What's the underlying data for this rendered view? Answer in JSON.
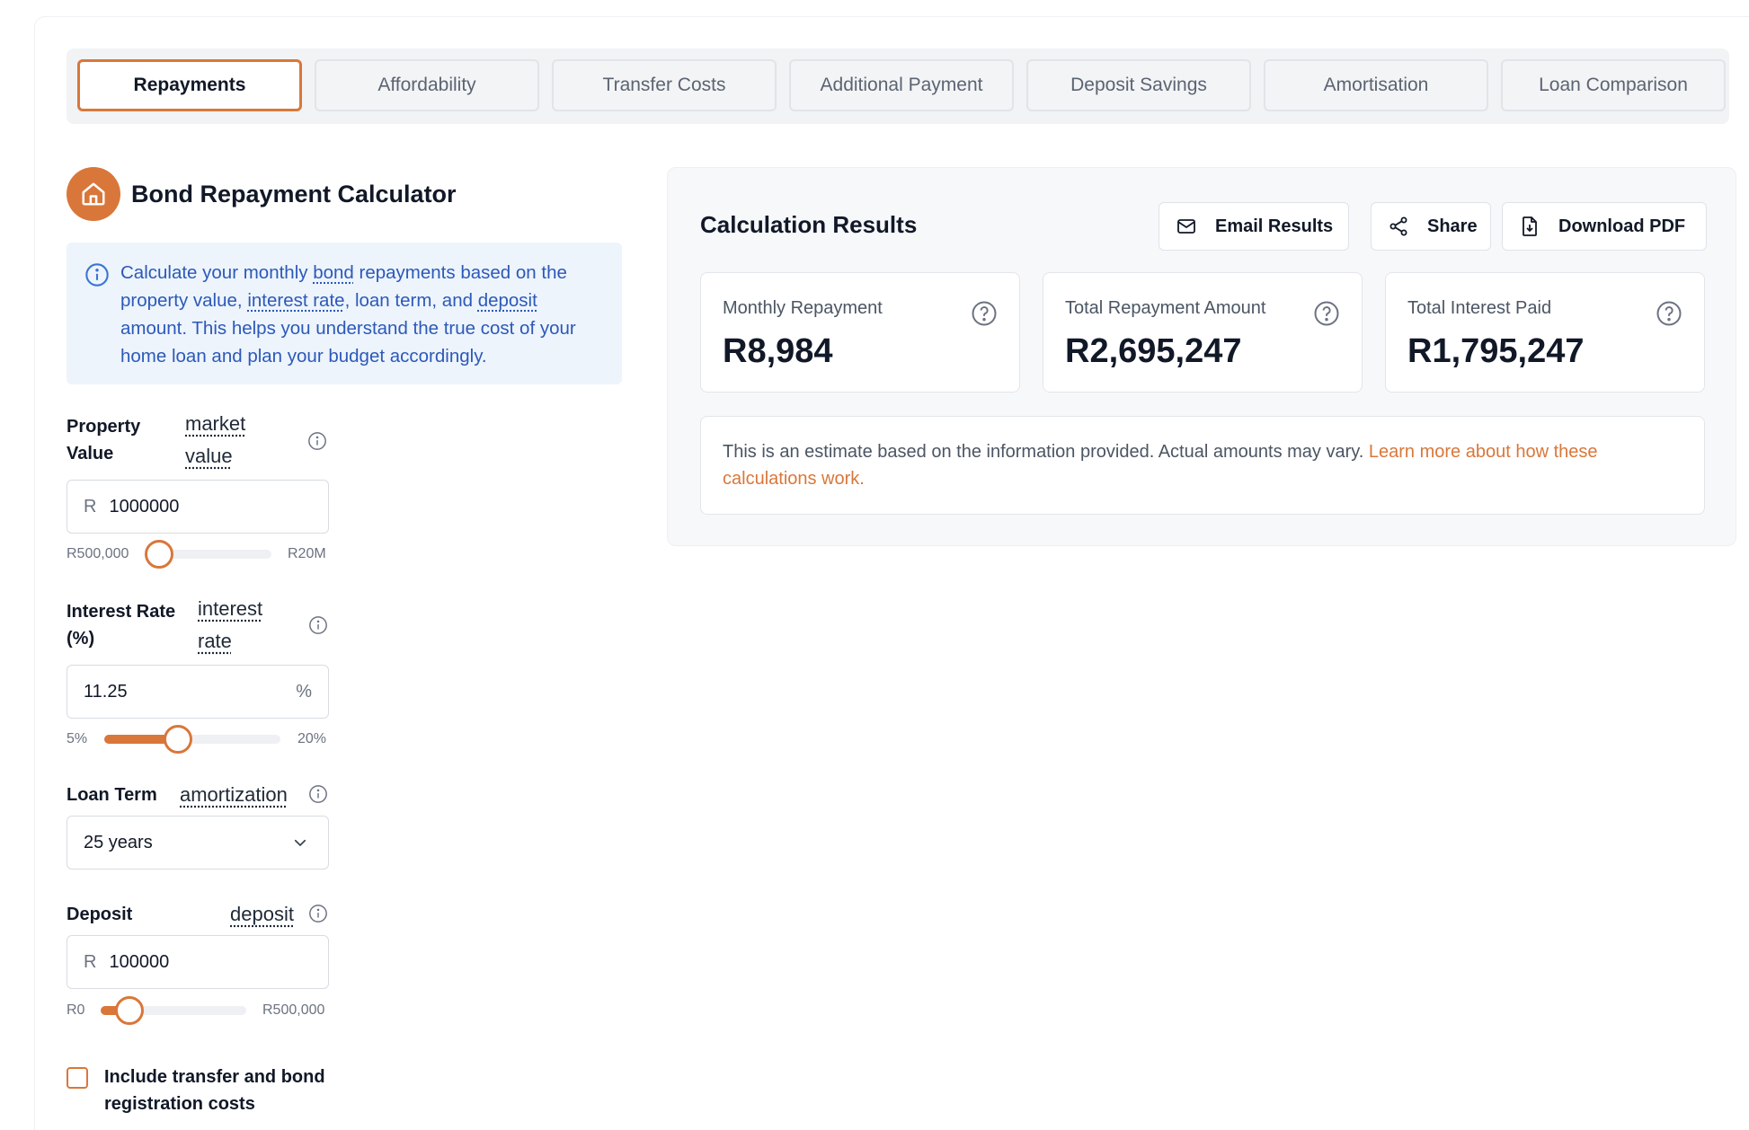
{
  "tabs": [
    {
      "label": "Repayments",
      "active": true
    },
    {
      "label": "Affordability",
      "active": false
    },
    {
      "label": "Transfer Costs",
      "active": false
    },
    {
      "label": "Additional Payment",
      "active": false
    },
    {
      "label": "Deposit Savings",
      "active": false
    },
    {
      "label": "Amortisation",
      "active": false
    },
    {
      "label": "Loan Comparison",
      "active": false
    }
  ],
  "calculator": {
    "title": "Bond Repayment Calculator",
    "icon": "home-icon",
    "info": {
      "icon": "info-icon",
      "t1": "Calculate your monthly ",
      "bond": "bond",
      "t2": " repayments based on the property value, ",
      "interest_rate": "interest rate",
      "t3": ", loan term, and ",
      "deposit": "deposit",
      "t4": " amount. This helps you understand the true cost of your home loan and plan your budget accordingly."
    },
    "property_value": {
      "label_line1": "Property",
      "label_line2": "Value",
      "term_line1": "market",
      "term_line2": "value",
      "prefix": "R",
      "value": "1000000",
      "min_label": "R500,000",
      "max_label": "R20M",
      "slider_position": 0.08
    },
    "interest_rate": {
      "label_line1": "Interest Rate",
      "label_line2": "(%)",
      "term_line1": "interest",
      "term_line2": "rate",
      "value": "11.25",
      "suffix": "%",
      "min_label": "5%",
      "max_label": "20%",
      "slider_position": 0.42
    },
    "loan_term": {
      "label": "Loan Term",
      "term": "amortization",
      "value": "25 years"
    },
    "deposit": {
      "label": "Deposit",
      "term": "deposit",
      "prefix": "R",
      "value": "100000",
      "min_label": "R0",
      "max_label": "R500,000",
      "slider_position": 0.2
    },
    "include_costs": {
      "label": "Include transfer and bond registration costs",
      "checked": false
    }
  },
  "results": {
    "title": "Calculation Results",
    "buttons": {
      "email": "Email Results",
      "share": "Share",
      "download": "Download PDF"
    },
    "metrics": [
      {
        "label": "Monthly Repayment",
        "value": "R8,984"
      },
      {
        "label": "Total Repayment Amount",
        "value": "R2,695,247"
      },
      {
        "label": "Total Interest Paid",
        "value": "R1,795,247"
      }
    ],
    "disclaimer": {
      "text": "This is an estimate based on the information provided. Actual amounts may vary. ",
      "link": "Learn more about how these calculations work."
    }
  },
  "colors": {
    "accent": "#d9773a",
    "info_bg": "#edf4fc",
    "info_text": "#2c59b8"
  }
}
